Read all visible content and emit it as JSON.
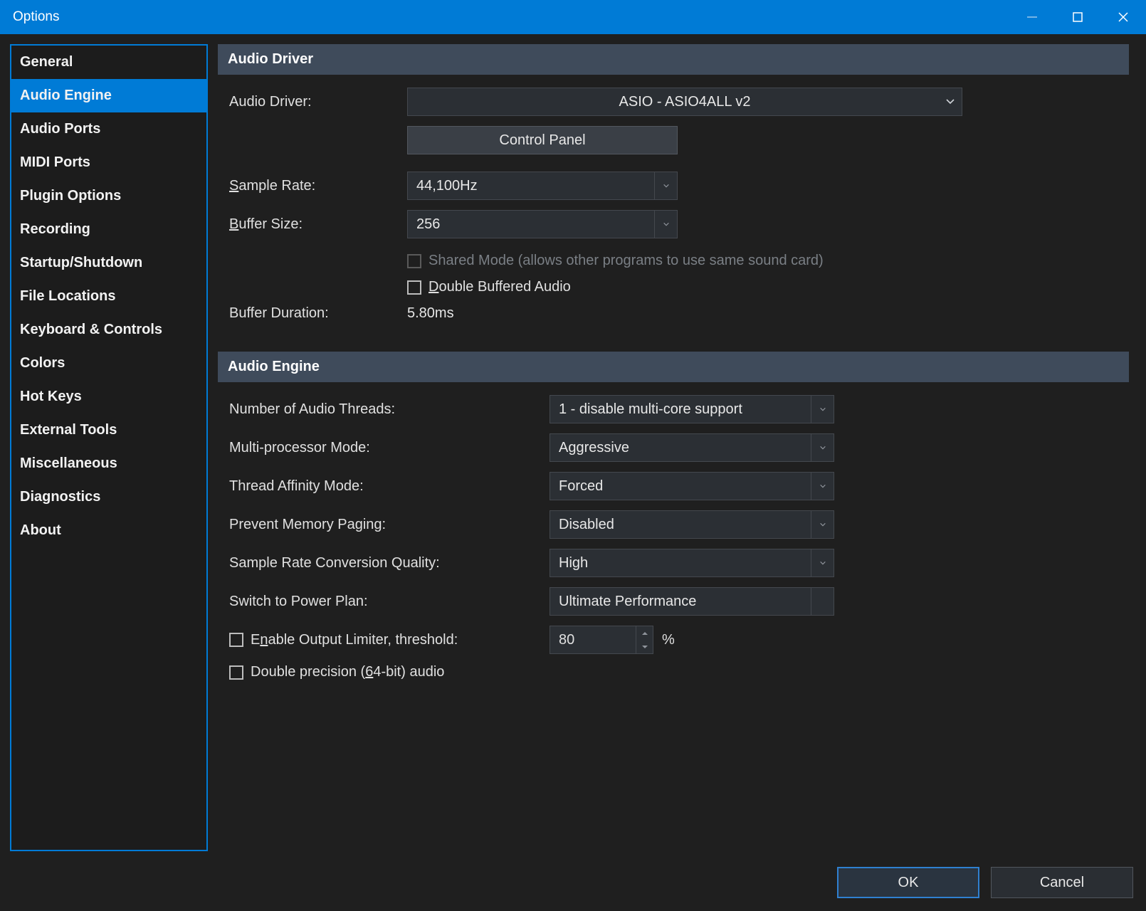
{
  "window": {
    "title": "Options"
  },
  "sidebar": {
    "items": [
      {
        "label": "General"
      },
      {
        "label": "Audio Engine",
        "selected": true
      },
      {
        "label": "Audio Ports"
      },
      {
        "label": "MIDI Ports"
      },
      {
        "label": "Plugin Options"
      },
      {
        "label": "Recording"
      },
      {
        "label": "Startup/Shutdown"
      },
      {
        "label": "File Locations"
      },
      {
        "label": "Keyboard & Controls"
      },
      {
        "label": "Colors"
      },
      {
        "label": "Hot Keys"
      },
      {
        "label": "External Tools"
      },
      {
        "label": "Miscellaneous"
      },
      {
        "label": "Diagnostics"
      },
      {
        "label": "About"
      }
    ]
  },
  "sections": {
    "driver": {
      "header": "Audio Driver",
      "audio_driver_label": "Audio Driver:",
      "audio_driver_value": "ASIO - ASIO4ALL v2",
      "control_panel_btn": "Control Panel",
      "sample_rate_label_pre": "S",
      "sample_rate_label_rest": "ample Rate:",
      "sample_rate_value": "44,100Hz",
      "buffer_size_label_pre": "B",
      "buffer_size_label_rest": "uffer Size:",
      "buffer_size_value": "256",
      "shared_mode_label": "Shared Mode (allows other programs to use same sound card)",
      "double_buffered_pre": "D",
      "double_buffered_rest": "ouble Buffered Audio",
      "buffer_duration_label": "Buffer Duration:",
      "buffer_duration_value": "5.80ms"
    },
    "engine": {
      "header": "Audio Engine",
      "threads_label_pre": "Number of Audio ",
      "threads_label_ul": "T",
      "threads_label_rest": "hreads:",
      "threads_value": "1 - disable multi-core support",
      "mp_mode_label_pre": "M",
      "mp_mode_label_rest": "ulti-processor Mode:",
      "mp_mode_value": "Aggressive",
      "affinity_label": "Thread Affinity Mode:",
      "affinity_value": "Forced",
      "paging_label_pre": "P",
      "paging_label_rest": "revent Memory Paging:",
      "paging_value": "Disabled",
      "src_label_pre": "Sample Rate Conversion ",
      "src_label_ul": "Q",
      "src_label_rest": "uality:",
      "src_value": "High",
      "power_label_pre": "S",
      "power_label_ul": "w",
      "power_label_rest": "itch to Power Plan:",
      "power_value": "Ultimate Performance",
      "limiter_label_pre": "E",
      "limiter_label_ul": "n",
      "limiter_label_rest": "able Output Limiter, threshold:",
      "limiter_value": "80",
      "limiter_unit": "%",
      "dbl_prec_pre": "Double precision (",
      "dbl_prec_ul": "6",
      "dbl_prec_rest": "4-bit) audio"
    }
  },
  "footer": {
    "ok": "OK",
    "cancel": "Cancel"
  }
}
